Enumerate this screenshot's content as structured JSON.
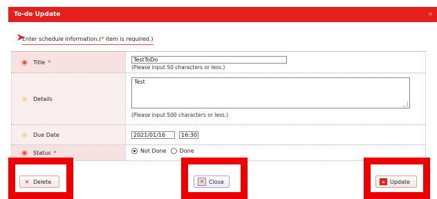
{
  "window": {
    "title": "To-do Update",
    "close_glyph": "×"
  },
  "instruction": {
    "text": "Enter schedule information.(",
    "star": "*",
    "suffix": " item is required.)"
  },
  "form": {
    "title": {
      "label": "Title",
      "value": "TestToDo",
      "hint": "(Please input 50 characters or less.)"
    },
    "details": {
      "label": "Details",
      "value": "Test",
      "hint": "(Please input 500 characters or less.)"
    },
    "due_date": {
      "label": "Due Date",
      "date": "2021/01/16",
      "time": "16:30"
    },
    "status": {
      "label": "Status",
      "options": [
        "Not Done",
        "Done"
      ],
      "selected": "Not Done"
    },
    "required_star": "*"
  },
  "buttons": {
    "delete": "Delete",
    "close": "Close",
    "update": "Update"
  },
  "colors": {
    "accent": "#e51e1e",
    "highlight": "#ef0000"
  }
}
